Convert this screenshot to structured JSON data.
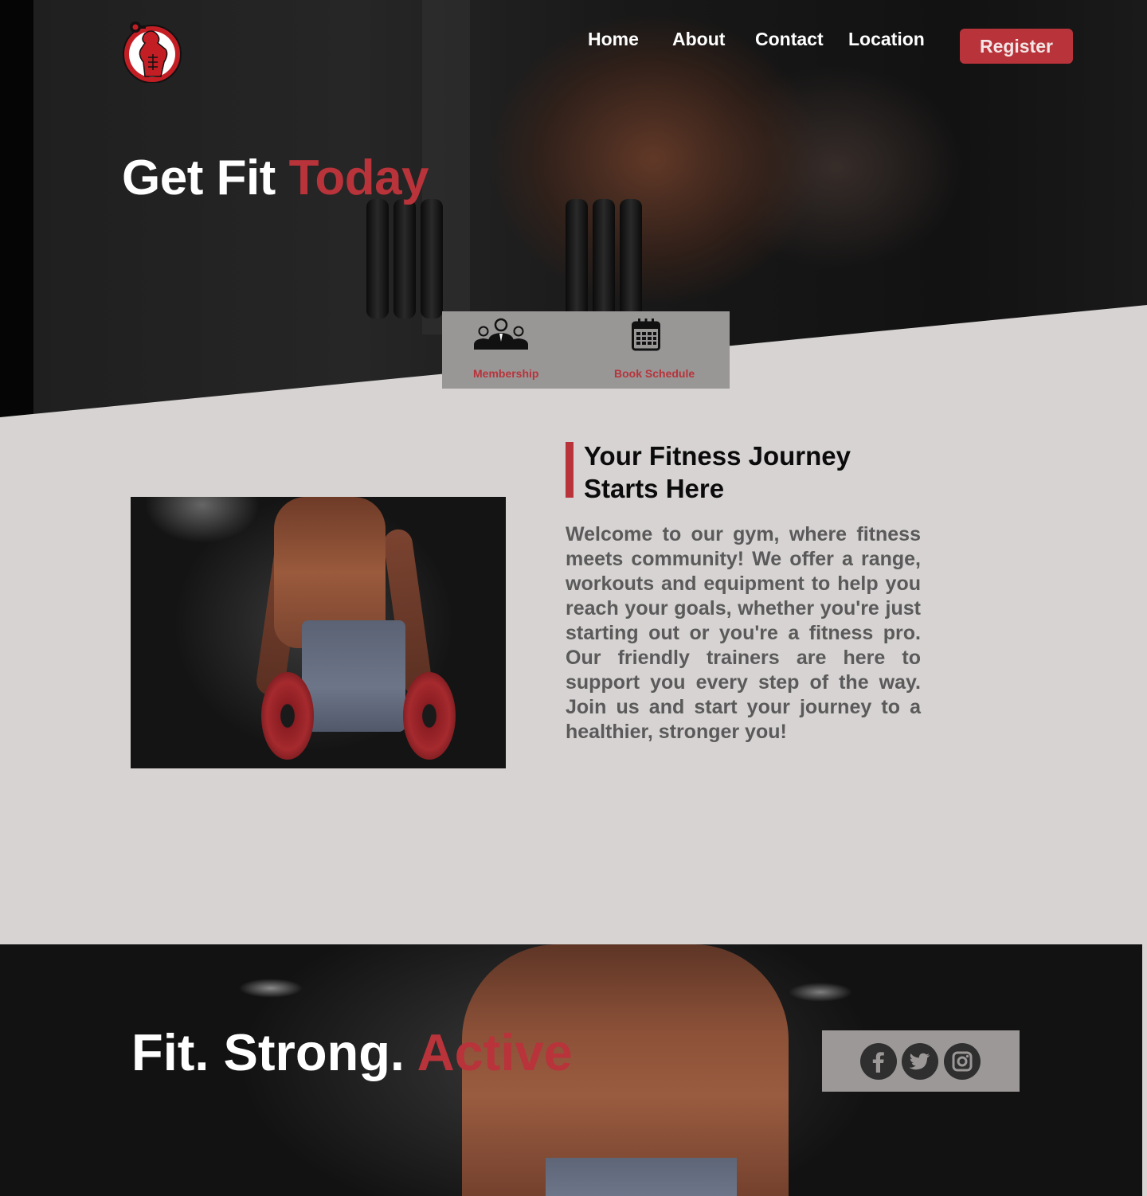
{
  "nav": {
    "links": [
      "Home",
      "About",
      "Contact",
      "Location"
    ],
    "register_label": "Register"
  },
  "hero": {
    "title_main": "Get Fit",
    "title_accent": "Today"
  },
  "quick_actions": [
    {
      "label": "Membership",
      "icon": "group-icon"
    },
    {
      "label": "Book Schedule",
      "icon": "calendar-icon"
    }
  ],
  "about": {
    "title": "Your Fitness Journey Starts Here",
    "text": "Welcome to our gym, where fitness meets community! We offer a range, workouts and equipment to help you reach your goals, whether you're just starting out or you're a fitness pro. Our friendly trainers are here to support you every step of the way. Join us and start your journey to a healthier, stronger you!"
  },
  "footer_banner": {
    "title_main": "Fit. Strong.",
    "title_accent": "Active",
    "social": [
      "facebook-icon",
      "twitter-icon",
      "instagram-icon"
    ]
  },
  "colors": {
    "accent": "#b8333a",
    "background": "#d6d3d2",
    "panel": "#999696"
  }
}
